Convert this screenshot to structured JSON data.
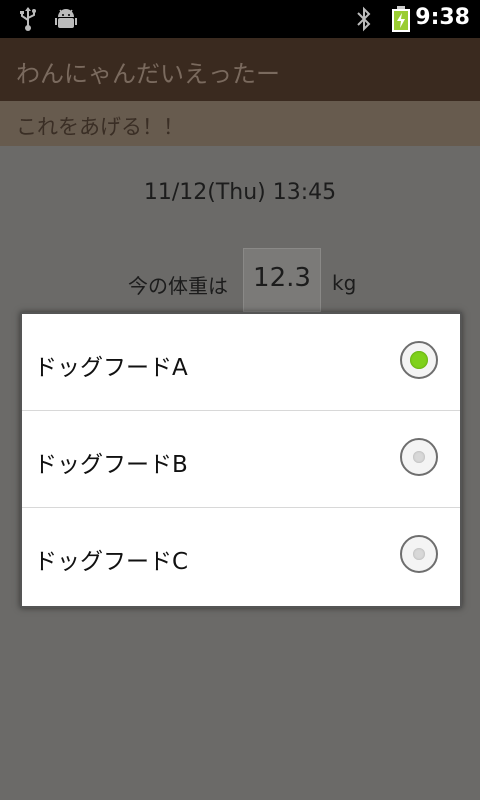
{
  "status_bar": {
    "time": "9:38",
    "icons": [
      "usb-icon",
      "android-debug-icon",
      "bluetooth-icon",
      "battery-charging-icon"
    ],
    "battery_color": "#9acd32"
  },
  "app": {
    "title": "わんにゃんだいえったー",
    "subtitle": "これをあげる！！"
  },
  "main": {
    "datetime": "11/12(Thu) 13:45",
    "weight_label": "今の体重は",
    "weight_value": "12.3",
    "weight_unit": "kg"
  },
  "dialog": {
    "options": [
      {
        "label": "ドッグフードA",
        "selected": true
      },
      {
        "label": "ドッグフードB",
        "selected": false
      },
      {
        "label": "ドッグフードC",
        "selected": false
      }
    ]
  },
  "colors": {
    "accent_radio": "#7fd11b",
    "title_bar": "#3a2a1f",
    "sub_bar": "#675b4e"
  }
}
